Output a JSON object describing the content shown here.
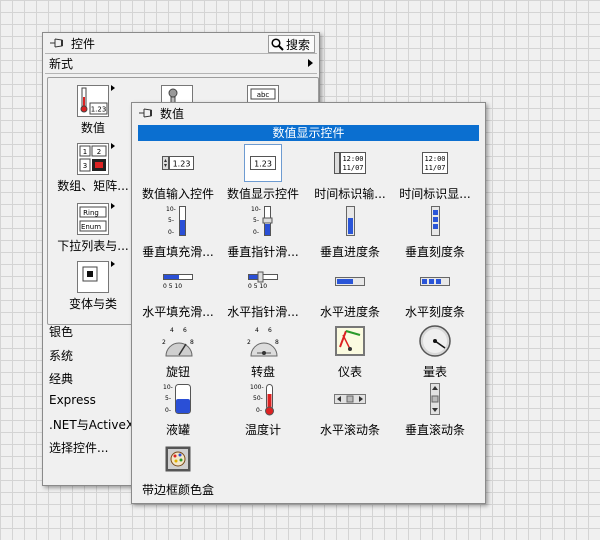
{
  "main_palette": {
    "title": "控件",
    "search_label": "搜索",
    "style_label": "新式",
    "categories": [
      {
        "label": "数值",
        "icon": "numeric-indicator-icon"
      },
      {
        "label": "",
        "icon": "boolean-icon"
      },
      {
        "label": "",
        "icon": "string-icon"
      },
      {
        "label": "数组、矩阵...",
        "icon": "array-matrix-icon"
      },
      {
        "label": "下拉列表与...",
        "icon": "ring-enum-icon"
      },
      {
        "label": "变体与类",
        "icon": "variant-class-icon"
      }
    ],
    "items": [
      "银色",
      "系统",
      "经典",
      "Express",
      ".NET与ActiveX",
      "选择控件..."
    ]
  },
  "sub_palette": {
    "title": "数值",
    "selected_label": "数值显示控件",
    "items": [
      {
        "label": "数值输入控件",
        "icon": "numeric-control-icon"
      },
      {
        "label": "数值显示控件",
        "icon": "numeric-indicator-icon"
      },
      {
        "label": "时间标识输...",
        "icon": "timestamp-control-icon"
      },
      {
        "label": "时间标识显...",
        "icon": "timestamp-indicator-icon"
      },
      {
        "label": "垂直填充滑...",
        "icon": "vertical-fill-slide-icon"
      },
      {
        "label": "垂直指针滑...",
        "icon": "vertical-pointer-slide-icon"
      },
      {
        "label": "垂直进度条",
        "icon": "vertical-progress-bar-icon"
      },
      {
        "label": "垂直刻度条",
        "icon": "vertical-graduated-bar-icon"
      },
      {
        "label": "水平填充滑...",
        "icon": "horizontal-fill-slide-icon"
      },
      {
        "label": "水平指针滑...",
        "icon": "horizontal-pointer-slide-icon"
      },
      {
        "label": "水平进度条",
        "icon": "horizontal-progress-bar-icon"
      },
      {
        "label": "水平刻度条",
        "icon": "horizontal-graduated-bar-icon"
      },
      {
        "label": "旋钮",
        "icon": "knob-icon"
      },
      {
        "label": "转盘",
        "icon": "dial-icon"
      },
      {
        "label": "仪表",
        "icon": "gauge-icon"
      },
      {
        "label": "量表",
        "icon": "meter-icon"
      },
      {
        "label": "液罐",
        "icon": "tank-icon"
      },
      {
        "label": "温度计",
        "icon": "thermometer-icon"
      },
      {
        "label": "水平滚动条",
        "icon": "horizontal-scrollbar-icon"
      },
      {
        "label": "垂直滚动条",
        "icon": "vertical-scrollbar-icon"
      },
      {
        "label": "带边框颜色盒",
        "icon": "framed-color-box-icon"
      }
    ]
  },
  "numbers": {
    "numeric_value": "1.23",
    "time_line1": "12:00",
    "time_line2": "11/07",
    "fill_slide_ticks": [
      "10-",
      "5-",
      "0-"
    ],
    "h_ticks": "0  5  10",
    "tank_ticks": [
      "10-",
      "5-",
      "0-"
    ],
    "thermo_ticks": [
      "100-",
      "50-",
      "0-"
    ],
    "dial_ticks": [
      "4",
      "6",
      "2",
      "8"
    ]
  }
}
